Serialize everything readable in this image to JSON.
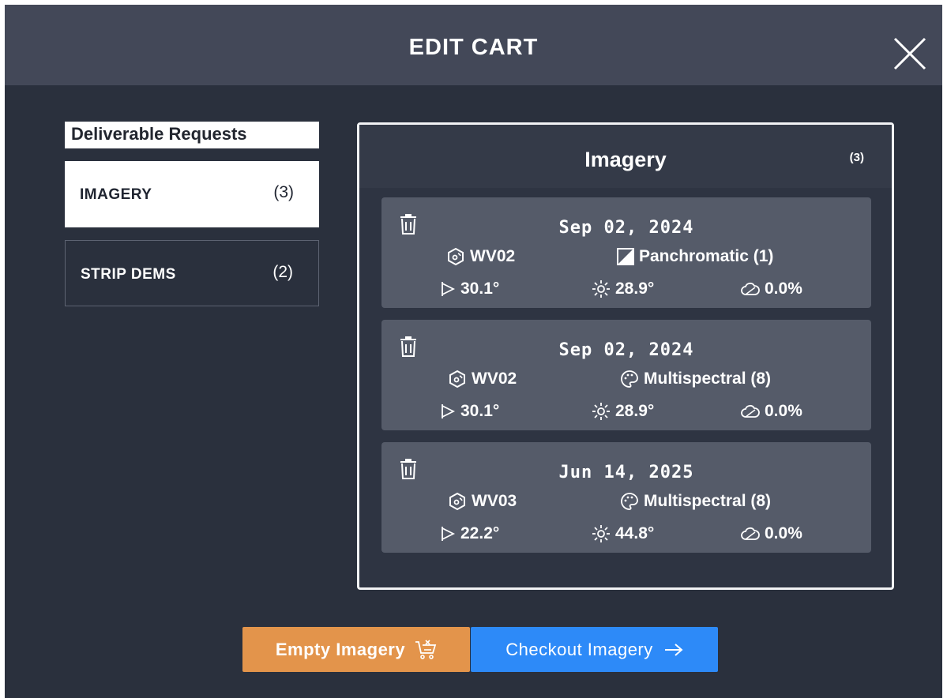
{
  "modal": {
    "title": "EDIT CART",
    "close_icon": "close-icon"
  },
  "sidebar": {
    "heading": "Deliverable Requests",
    "tabs": [
      {
        "label": "IMAGERY",
        "count": "(3)",
        "active": true
      },
      {
        "label": "STRIP DEMS",
        "count": "(2)",
        "active": false
      }
    ]
  },
  "panel": {
    "title": "Imagery",
    "count": "(3)",
    "items": [
      {
        "date": "Sep 02, 2024",
        "sensor": "WV02",
        "band": "Panchromatic (1)",
        "band_icon": "panchromatic-icon",
        "off_nadir": "30.1°",
        "sun_elevation": "28.9°",
        "cloud_cover": "0.0%"
      },
      {
        "date": "Sep 02, 2024",
        "sensor": "WV02",
        "band": "Multispectral (8)",
        "band_icon": "palette-icon",
        "off_nadir": "30.1°",
        "sun_elevation": "28.9°",
        "cloud_cover": "0.0%"
      },
      {
        "date": "Jun 14, 2025",
        "sensor": "WV03",
        "band": "Multispectral (8)",
        "band_icon": "palette-icon",
        "off_nadir": "22.2°",
        "sun_elevation": "44.8°",
        "cloud_cover": "0.0%"
      }
    ]
  },
  "actions": {
    "empty_label": "Empty Imagery",
    "empty_icon": "empty-cart-icon",
    "checkout_label": "Checkout Imagery",
    "checkout_icon": "arrow-right-icon"
  },
  "colors": {
    "header": "#434858",
    "background": "#2a303d",
    "card": "#555b69",
    "empty_button": "#e3944b",
    "checkout_button": "#2d8af8"
  }
}
